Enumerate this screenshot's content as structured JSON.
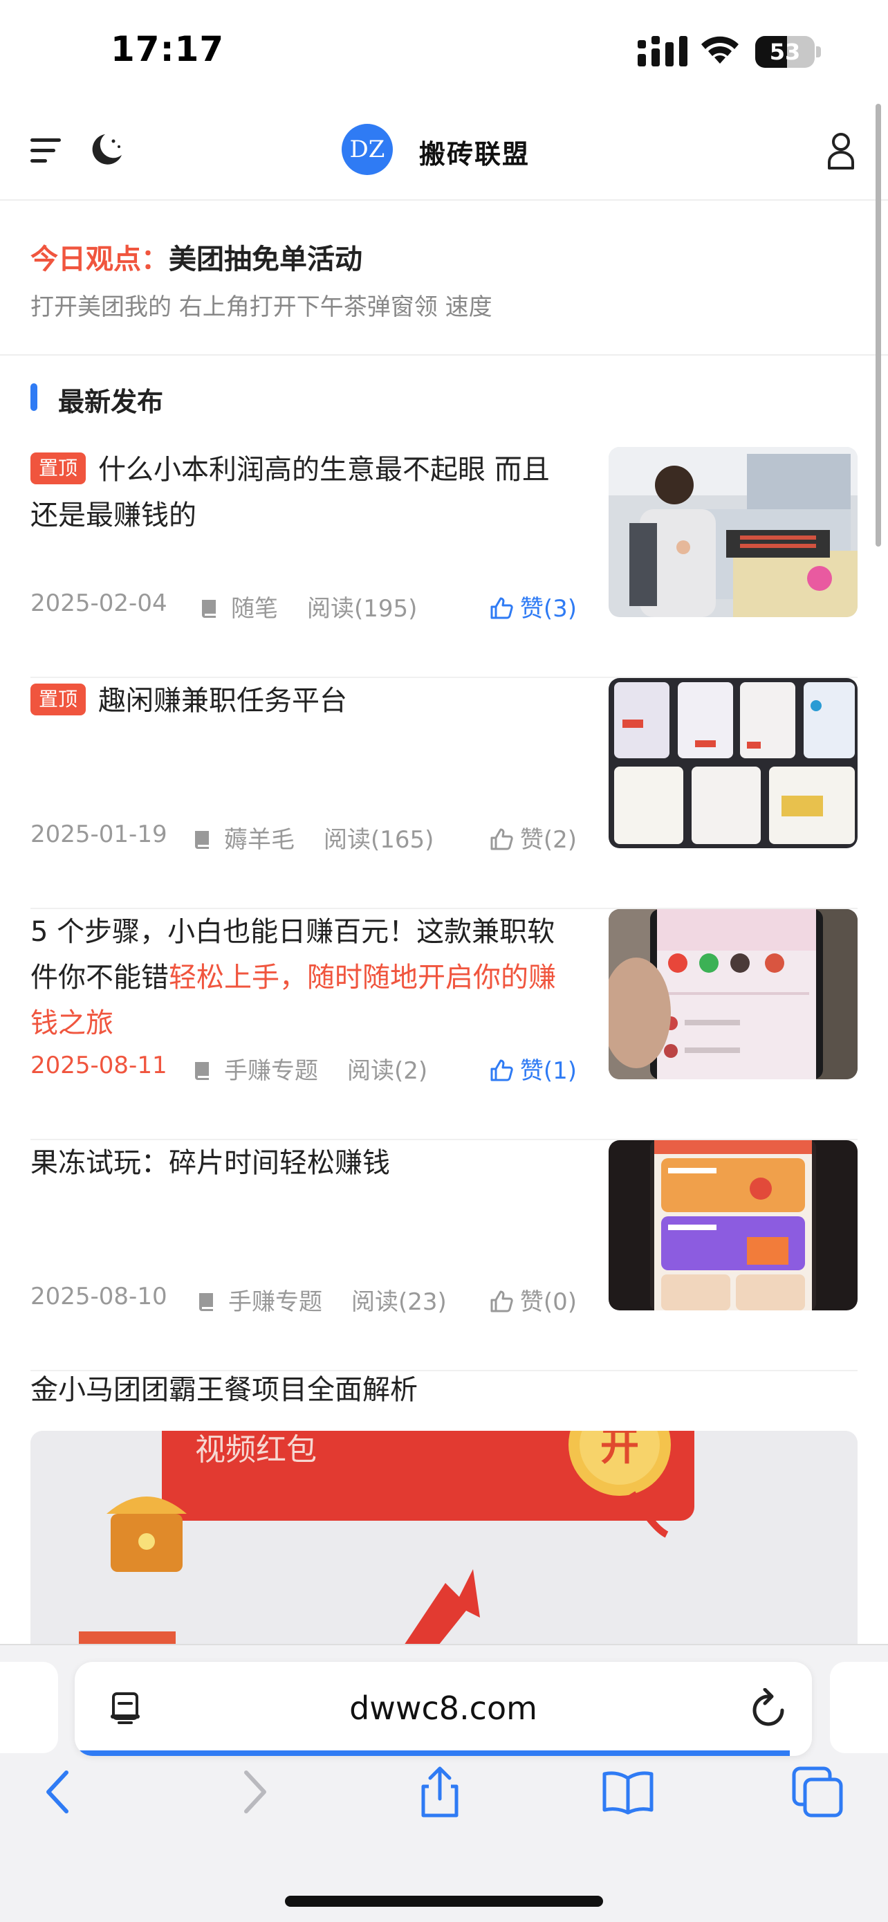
{
  "status_bar": {
    "time": "17:17",
    "battery_level": "53",
    "battery_fraction": 0.53
  },
  "header": {
    "logo_text": "DZ",
    "site_name": "搬砖联盟",
    "icons": [
      "menu-icon",
      "moon-icon",
      "user-icon"
    ]
  },
  "today": {
    "label": "今日观点：",
    "title": "美团抽免单活动",
    "desc": "打开美团我的 右上角打开下午茶弹窗领 速度"
  },
  "section": {
    "title": "最新发布"
  },
  "articles": [
    {
      "pin": "置顶",
      "title": "什么小本利润高的生意最不起眼 而且还是最赚钱的",
      "highlight": "",
      "date": "2025-02-04",
      "category": "随笔",
      "reads": "阅读(195)",
      "likes": "赞(3)"
    },
    {
      "pin": "置顶",
      "title": "趣闲赚兼职任务平台",
      "highlight": "",
      "date": "2025-01-19",
      "category": "薅羊毛",
      "reads": "阅读(165)",
      "likes": "赞(2)"
    },
    {
      "pin": "",
      "title": "5 个步骤，小白也能日赚百元！这款兼职软件你不能错",
      "highlight": "轻松上手，随时随地开启你的赚钱之旅",
      "date": "2025-08-11",
      "category": "手赚专题",
      "reads": "阅读(2)",
      "likes": "赞(1)"
    },
    {
      "pin": "",
      "title": "果冻试玩：碎片时间轻松赚钱",
      "highlight": "",
      "date": "2025-08-10",
      "category": "手赚专题",
      "reads": "阅读(23)",
      "likes": "赞(0)"
    }
  ],
  "last_article": {
    "title": "金小马团团霸王餐项目全面解析",
    "image_text": "视频红包",
    "image_badge": "开"
  },
  "browser": {
    "address": "dwwc8.com",
    "load_progress": 0.97,
    "toolbar": [
      "back-icon",
      "forward-icon",
      "share-icon",
      "bookmarks-icon",
      "tabs-icon"
    ]
  },
  "colors": {
    "accent": "#2f7bf4",
    "red": "#f0553e",
    "muted": "#999999"
  }
}
